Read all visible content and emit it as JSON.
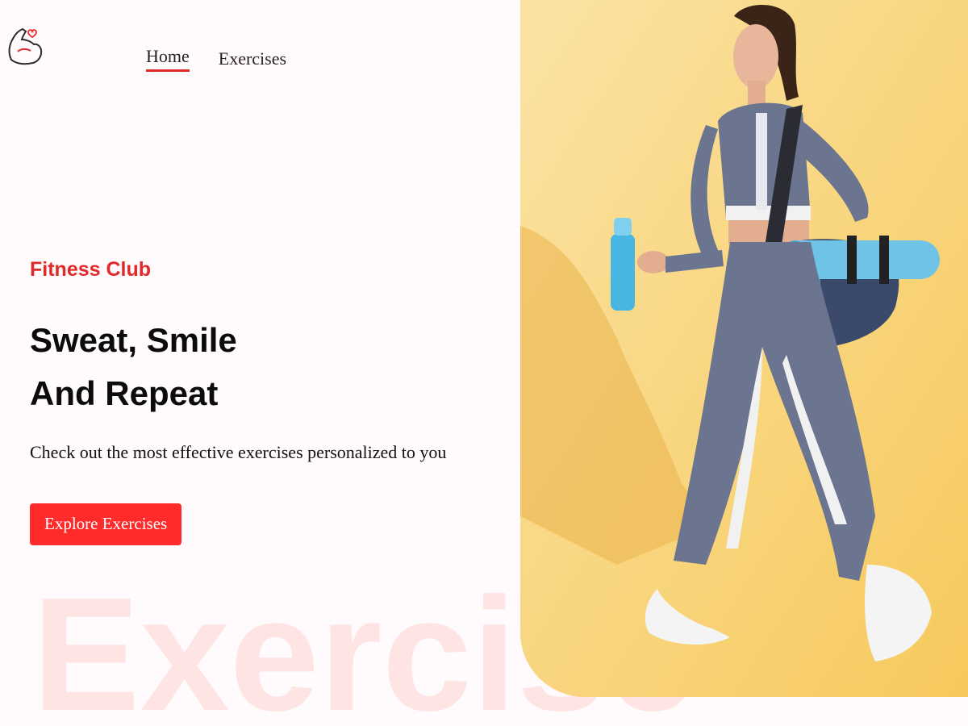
{
  "logo": {
    "icon": "flexed-arm-heart-icon"
  },
  "nav": {
    "items": [
      {
        "label": "Home",
        "active": true
      },
      {
        "label": "Exercises",
        "active": false
      }
    ]
  },
  "hero": {
    "eyebrow": "Fitness Club",
    "headline_line1": "Sweat, Smile",
    "headline_line2": "And Repeat",
    "subtitle": "Check out the most effective exercises personalized to you",
    "cta_label": "Explore Exercises"
  },
  "watermark": "Exercise",
  "colors": {
    "accent": "#ff2a2a",
    "background": "#fffafb",
    "image_background": "#fbd88a"
  }
}
